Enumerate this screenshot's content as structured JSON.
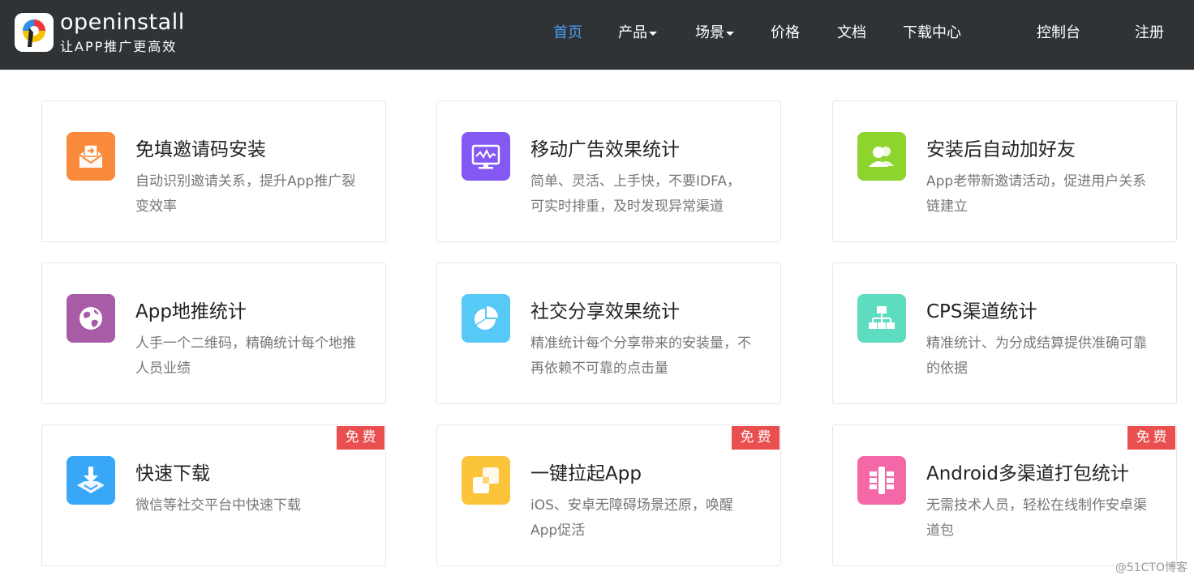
{
  "brand": {
    "name": "openinstall",
    "slogan": "让APP推广更高效"
  },
  "nav": {
    "home": "首页",
    "products": "产品",
    "scenarios": "场景",
    "pricing": "价格",
    "docs": "文档",
    "downloads": "下载中心",
    "console": "控制台",
    "register": "注册"
  },
  "cards": [
    {
      "title": "免填邀请码安装",
      "desc": "自动识别邀请关系，提升App推广裂变效率",
      "icon": "envelope-icon",
      "color": "#fa8a3c",
      "badge": ""
    },
    {
      "title": "移动广告效果统计",
      "desc": "简单、灵活、上手快，不要IDFA，可实时排重，及时发现异常渠道",
      "icon": "monitor-chart-icon",
      "color": "#8458f3",
      "badge": ""
    },
    {
      "title": "安装后自动加好友",
      "desc": "App老带新邀请活动，促进用户关系链建立",
      "icon": "users-icon",
      "color": "#8dd42f",
      "badge": ""
    },
    {
      "title": "App地推统计",
      "desc": "人手一个二维码，精确统计每个地推人员业绩",
      "icon": "globe-icon",
      "color": "#a85ba6",
      "badge": ""
    },
    {
      "title": "社交分享效果统计",
      "desc": "精准统计每个分享带来的安装量，不再依赖不可靠的点击量",
      "icon": "pie-chart-icon",
      "color": "#56c9f7",
      "badge": ""
    },
    {
      "title": "CPS渠道统计",
      "desc": "精准统计、为分成结算提供准确可靠的依据",
      "icon": "hierarchy-icon",
      "color": "#5ddcbf",
      "badge": ""
    },
    {
      "title": "快速下载",
      "desc": "微信等社交平台中快速下载",
      "icon": "download-tray-icon",
      "color": "#39a7f7",
      "badge": "免费"
    },
    {
      "title": "一键拉起App",
      "desc": "iOS、安卓无障碍场景还原，唤醒App促活",
      "icon": "overlap-squares-icon",
      "color": "#fbc43a",
      "badge": "免费"
    },
    {
      "title": "Android多渠道打包统计",
      "desc": "无需技术人员，轻松在线制作安卓渠道包",
      "icon": "package-grid-icon",
      "color": "#f468a8",
      "badge": "免费"
    }
  ],
  "watermark": "@51CTO博客"
}
